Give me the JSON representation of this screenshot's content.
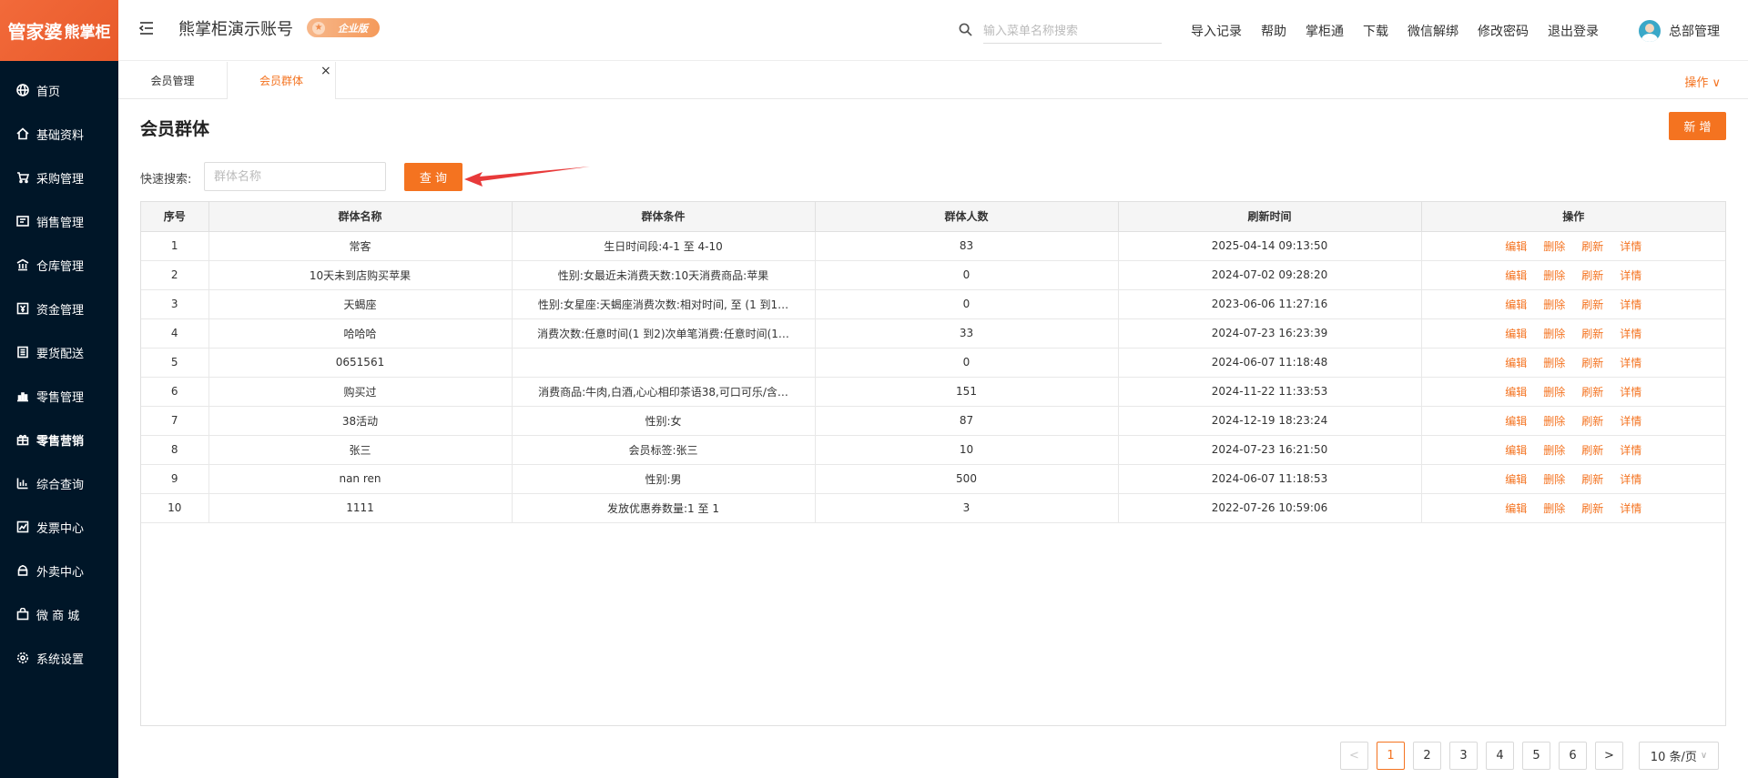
{
  "sidebar": {
    "logo_main": "管家婆",
    "logo_sub": "熊掌柜",
    "items": [
      {
        "label": "首页",
        "icon": "globe-icon"
      },
      {
        "label": "基础资料",
        "icon": "home-icon"
      },
      {
        "label": "采购管理",
        "icon": "cart-icon"
      },
      {
        "label": "销售管理",
        "icon": "sales-icon"
      },
      {
        "label": "仓库管理",
        "icon": "warehouse-icon"
      },
      {
        "label": "资金管理",
        "icon": "money-icon"
      },
      {
        "label": "要货配送",
        "icon": "list-icon"
      },
      {
        "label": "零售管理",
        "icon": "bar-chart-icon"
      },
      {
        "label": "零售营销",
        "icon": "gift-icon"
      },
      {
        "label": "综合查询",
        "icon": "chart-icon"
      },
      {
        "label": "发票中心",
        "icon": "trend-icon"
      },
      {
        "label": "外卖中心",
        "icon": "delivery-icon"
      },
      {
        "label": "微 商 城",
        "icon": "shop-icon"
      },
      {
        "label": "系统设置",
        "icon": "gear-icon"
      }
    ],
    "active_index": 8
  },
  "header": {
    "account_title": "熊掌柜演示账号",
    "badge": "企业版",
    "search_placeholder": "输入菜单名称搜索",
    "links": [
      "导入记录",
      "帮助",
      "掌柜通",
      "下载",
      "微信解绑",
      "修改密码",
      "退出登录"
    ],
    "user_name": "总部管理"
  },
  "tabs": {
    "items": [
      "会员管理",
      "会员群体"
    ],
    "close": "×",
    "ops": "操作 ∨"
  },
  "main": {
    "title": "会员群体",
    "add_label": "新 增",
    "quick_search_label": "快速搜索:",
    "quick_search_placeholder": "群体名称",
    "query_label": "查 询"
  },
  "table": {
    "columns": [
      "序号",
      "群体名称",
      "群体条件",
      "群体人数",
      "刷新时间",
      "操作"
    ],
    "rows": [
      [
        "1",
        "常客",
        "生日时间段:4-1 至 4-10",
        "83",
        "2025-04-14 09:13:50"
      ],
      [
        "2",
        "10天未到店购买苹果",
        "性别:女最近未消费天数:10天消费商品:苹果",
        "0",
        "2024-07-02 09:28:20"
      ],
      [
        "3",
        "天蝎座",
        "性别:女星座:天蝎座消费次数:相对时间, 至 (1 到1…",
        "0",
        "2023-06-06 11:27:16"
      ],
      [
        "4",
        "哈哈哈",
        "消费次数:任意时间(1 到2)次单笔消费:任意时间(1…",
        "33",
        "2024-07-23 16:23:39"
      ],
      [
        "5",
        "0651561",
        "",
        "0",
        "2024-06-07 11:18:48"
      ],
      [
        "6",
        "购买过",
        "消费商品:牛肉,白酒,心心相印茶语38,可口可乐/含…",
        "151",
        "2024-11-22 11:33:53"
      ],
      [
        "7",
        "38活动",
        "性别:女",
        "87",
        "2024-12-19 18:23:24"
      ],
      [
        "8",
        "张三",
        "会员标签:张三",
        "10",
        "2024-07-23 16:21:50"
      ],
      [
        "9",
        "nan ren",
        "性别:男",
        "500",
        "2024-06-07 11:18:53"
      ],
      [
        "10",
        "1111",
        "发放优惠券数量:1 至 1",
        "3",
        "2022-07-26 10:59:06"
      ]
    ],
    "actions": [
      "编辑",
      "删除",
      "刷新",
      "详情"
    ]
  },
  "pagination": {
    "prev": "<",
    "pages": [
      "1",
      "2",
      "3",
      "4",
      "5",
      "6"
    ],
    "current": "1",
    "next": ">",
    "page_size": "10 条/页"
  },
  "colors": {
    "accent": "#f47320",
    "sidebar_bg": "#001628"
  }
}
